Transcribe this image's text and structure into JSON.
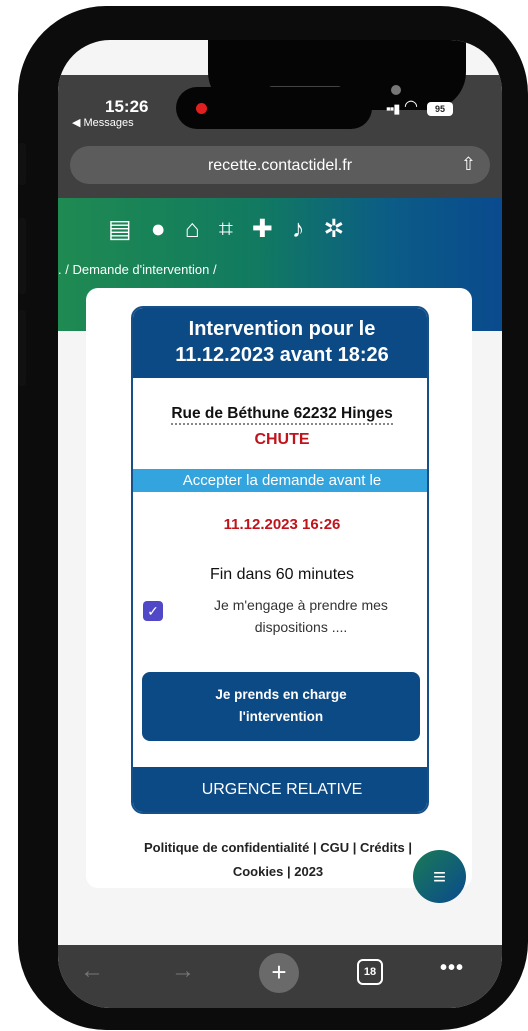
{
  "status": {
    "time": "15:26",
    "back_label": "◀ Messages",
    "battery": "95"
  },
  "browser": {
    "url": "recette.contactidel.fr",
    "tabs_count": "18"
  },
  "nav_icons": [
    "document-icon",
    "user-icon",
    "home-icon",
    "map-icon",
    "ambulance-icon",
    "bell-icon",
    "settings-icon"
  ],
  "breadcrumb": ". / Demande d'intervention /",
  "intervention": {
    "title_line1": "Intervention pour le",
    "title_line2": "11.12.2023 avant 18:26",
    "address": "Rue de Béthune 62232 Hinges",
    "type": "CHUTE",
    "accept_banner": "Accepter la demande avant le",
    "deadline": "11.12.2023 16:26",
    "countdown": "Fin dans 60 minutes",
    "checkbox_checked": true,
    "engage_text": "Je m'engage à prendre mes dispositions ....",
    "take_btn_line1": "Je prends en charge",
    "take_btn_line2": "l'intervention",
    "urgency": "URGENCE RELATIVE"
  },
  "footer": {
    "line1": "Politique de confidentialité | CGU | Crédits |",
    "line2": "Cookies | 2023"
  },
  "colors": {
    "primary": "#0c4a86",
    "accent": "#33a4de",
    "alert": "#c0131b",
    "checkbox": "#5148c8"
  }
}
